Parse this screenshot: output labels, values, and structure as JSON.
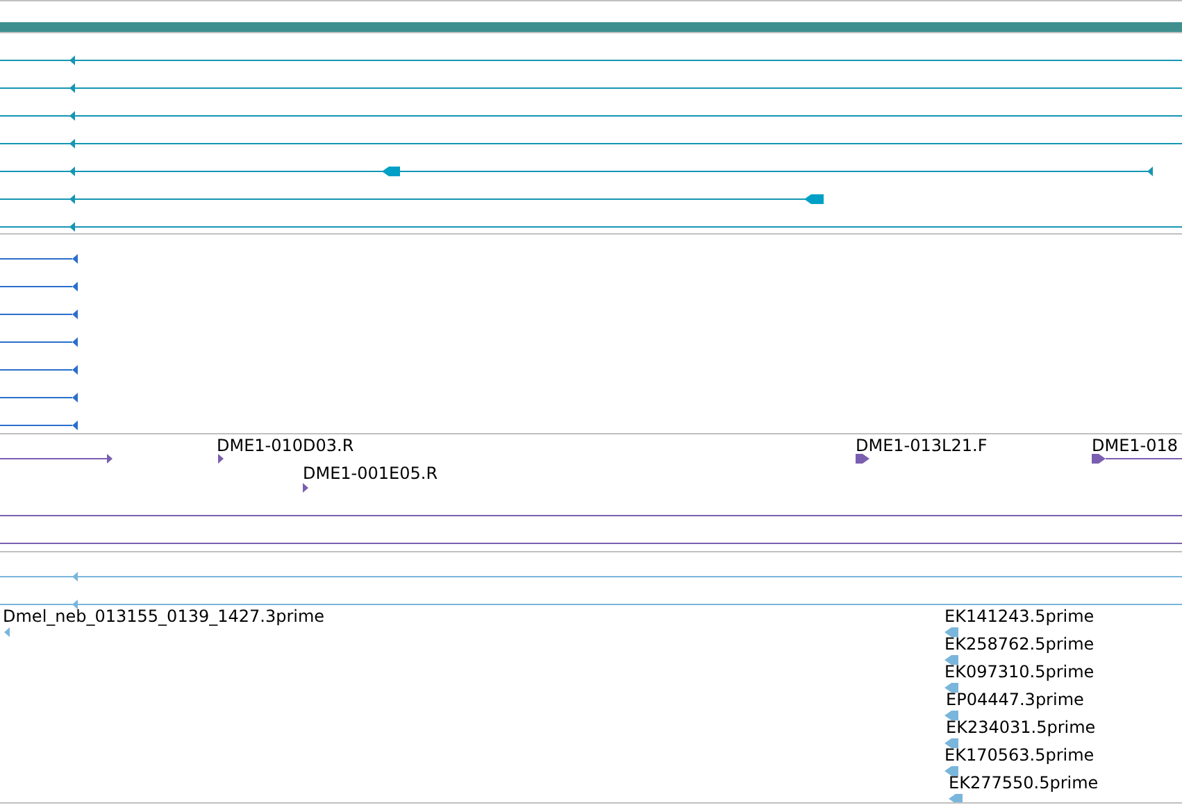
{
  "tracks": [
    {
      "kind": "transcripts",
      "color": "#1596b3"
    },
    {
      "kind": "stubs",
      "color": "#2b6fcc"
    },
    {
      "kind": "reads",
      "color": "#7a5fb0",
      "labels": [
        "DME1-010D03.R",
        "DME1-001E05.R",
        "DME1-013L21.F",
        "DME1-018"
      ]
    },
    {
      "kind": "ests",
      "color": "#7ab6dc",
      "labels": [
        "Dmel_neb_013155_0139_1427.3prime",
        "EK141243.5prime",
        "EK258762.5prime",
        "EK097310.5prime",
        "EP04447.3prime",
        "EK234031.5prime",
        "EK170563.5prime",
        "EK277550.5prime"
      ]
    }
  ]
}
